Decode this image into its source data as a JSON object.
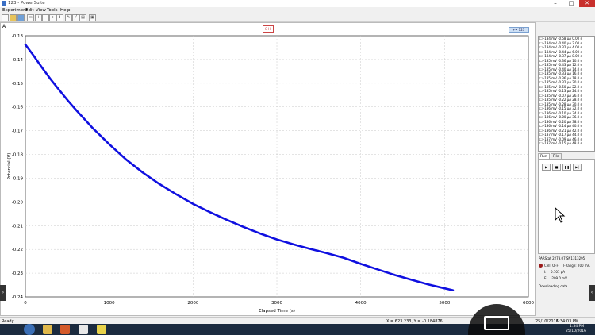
{
  "window": {
    "title": "123 - PowerSuite",
    "controls": [
      "–",
      "□",
      "✕"
    ]
  },
  "menu": [
    "Experiment",
    "Edit",
    "View",
    "Tools",
    "Help"
  ],
  "graph": {
    "corner_label": "A",
    "top_button": "C Hi"
  },
  "chart_data": {
    "type": "line",
    "title": "",
    "xlabel": "Elapsed Time (s)",
    "ylabel": "Potential (V)",
    "xlim": [
      0,
      6000
    ],
    "ylim": [
      -0.24,
      -0.13
    ],
    "xticks": [
      0,
      1000,
      2000,
      3000,
      4000,
      5000,
      6000
    ],
    "yticks": [
      -0.13,
      -0.14,
      -0.15,
      -0.16,
      -0.17,
      -0.18,
      -0.19,
      -0.2,
      -0.21,
      -0.22,
      -0.23,
      -0.24
    ],
    "ytick_labels": [
      "-0.13",
      "-0.14",
      "-0.15",
      "-0.16",
      "-0.17",
      "-0.18",
      "-0.19",
      "-0.20",
      "-0.21",
      "-0.22",
      "-0.23",
      "-0.24"
    ],
    "grid": true,
    "color": "#1010e0",
    "series": [
      {
        "x": [
          0,
          100,
          200,
          300,
          400,
          500,
          600,
          800,
          1000,
          1200,
          1400,
          1600,
          1800,
          2000,
          2200,
          2400,
          2600,
          2800,
          3000,
          3200,
          3400,
          3600,
          3800,
          4000,
          4200,
          4400,
          4600,
          4800,
          5000,
          5100
        ],
        "y": [
          -0.1337,
          -0.1385,
          -0.1435,
          -0.1483,
          -0.1527,
          -0.157,
          -0.1611,
          -0.1688,
          -0.1757,
          -0.1821,
          -0.1876,
          -0.1925,
          -0.1968,
          -0.2008,
          -0.2043,
          -0.2075,
          -0.2105,
          -0.2133,
          -0.2158,
          -0.2179,
          -0.2198,
          -0.2216,
          -0.2236,
          -0.2261,
          -0.2284,
          -0.2307,
          -0.2327,
          -0.2347,
          -0.2364,
          -0.2372
        ]
      }
    ]
  },
  "scale_widget": "123",
  "side": {
    "log": [
      "-134 mV  -0.58 µA   0.00 s",
      "-134 mV  -0.40 µA   2.00 s",
      "-134 mV  -0.32 µA   4.00 s",
      "-134 mV  -0.44 µA   6.00 s",
      "-134 mV  -0.37 µA   8.00 s",
      "-135 mV  -0.36 µA  10.0 s",
      "-135 mV  -0.43 µA  12.0 s",
      "-135 mV  -0.40 µA  14.0 s",
      "-135 mV  -0.33 µA  16.0 s",
      "-135 mV  -0.36 µA  18.0 s",
      "-135 mV  -0.32 µA  20.0 s",
      "-135 mV  -0.50 µA  22.0 s",
      "-135 mV  -0.13 µA  24.0 s",
      "-135 mV  -0.07 µA  26.0 s",
      "-135 mV  -0.22 µA  28.0 s",
      "-135 mV  -0.28 µA  30.0 s",
      "-136 mV  -0.15 µA  32.0 s",
      "-136 mV  -0.10 µA  34.0 s",
      "-136 mV  -0.00 µA  36.0 s",
      "-136 mV  -0.20 µA  38.0 s",
      "-136 mV  -0.14 µA  40.0 s",
      "-136 mV  -0.21 µA  42.0 s",
      "-137 mV  -0.17 µA  44.0 s",
      "-137 mV  -0.09 µA  46.0 s",
      "-137 mV  -0.15 µA  48.0 s"
    ],
    "tabs": [
      "Run",
      "File"
    ],
    "controls": [
      "▶",
      "■",
      "❚❚",
      "▶|"
    ],
    "device": "PARStat 2273.07 SN1313295",
    "cell_label": "Cell: OFF",
    "irange": "I-Range: 200 mA",
    "i_label": "I:",
    "i_value": "0.101 µA",
    "e_label": "E:",
    "e_value": "-209.0 mV",
    "downloading": "Downloading data..."
  },
  "status": {
    "left": "Ready",
    "coords": "X = 623.233, Y = -0.184876",
    "date1": "25/10/2016",
    "time1": "1:34:03 PM",
    "date2": "25/10/2016"
  },
  "taskbar": {
    "time": "1:34 PM",
    "date": "25/10/2016"
  }
}
